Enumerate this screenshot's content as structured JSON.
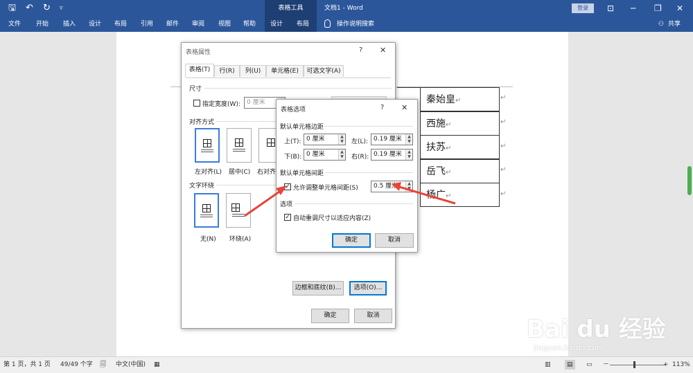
{
  "titlebar": {
    "context_tab": "表格工具",
    "doc_title": "文档1  -  Word",
    "login": "登录",
    "qat_save": "🖫",
    "qat_undo": "↶",
    "qat_redo": "↻",
    "qat_more": "▿",
    "win_ribbon_opts": "⊡",
    "win_min": "─",
    "win_restore": "❐",
    "win_close": "✕"
  },
  "ribbon": {
    "tabs": [
      "文件",
      "开始",
      "插入",
      "设计",
      "布局",
      "引用",
      "邮件",
      "审阅",
      "视图",
      "帮助",
      "设计",
      "布局"
    ],
    "tell_me": "操作说明搜索",
    "share": "共享"
  },
  "document": {
    "cells": [
      "秦始皇",
      "西施",
      "扶苏",
      "岳飞",
      "杨广"
    ],
    "para_mark": "↵"
  },
  "table_props": {
    "title": "表格属性",
    "help": "?",
    "close": "✕",
    "tabs": [
      "表格(T)",
      "行(R)",
      "列(U)",
      "单元格(E)",
      "可选文字(A)"
    ],
    "size_label": "尺寸",
    "pref_width_label": "指定宽度(W):",
    "pref_width_value": "0 厘米",
    "align_label": "对齐方式",
    "align_left": "左对齐(L)",
    "align_center": "居中(C)",
    "align_right": "右对齐",
    "wrap_label": "文字环绕",
    "wrap_none": "无(N)",
    "wrap_around": "环绕(A)",
    "borders_button": "边框和底纹(B)...",
    "options_button": "选项(O)...",
    "ok": "确定",
    "cancel": "取消"
  },
  "table_options": {
    "title": "表格选项",
    "help": "?",
    "close": "✕",
    "margins_label": "默认单元格边距",
    "top_label": "上(T):",
    "top_value": "0 厘米",
    "left_label": "左(L):",
    "left_value": "0.19 厘米",
    "bottom_label": "下(B):",
    "bottom_value": "0 厘米",
    "right_label": "右(R):",
    "right_value": "0.19 厘米",
    "spacing_label": "默认单元格间距",
    "allow_spacing_label": "允许调整单元格间距(S)",
    "spacing_value": "0.5 厘米",
    "options_label": "选项",
    "autoresize_label": "自动重调尺寸以适应内容(Z)",
    "ok": "确定",
    "cancel": "取消"
  },
  "statusbar": {
    "page": "第 1 页，共 1 页",
    "words": "49/49 个字",
    "lang": "中文(中国)",
    "zoom_minus": "－",
    "zoom_plus": "+",
    "zoom": "113%"
  },
  "watermark": {
    "text": "Bai du 经验",
    "url": "jingyan.baidu.com"
  },
  "colors": {
    "ribbon": "#2b579a",
    "context": "#1e3f73",
    "arrow": "#e8443a",
    "selected": "#3d7bd9"
  }
}
